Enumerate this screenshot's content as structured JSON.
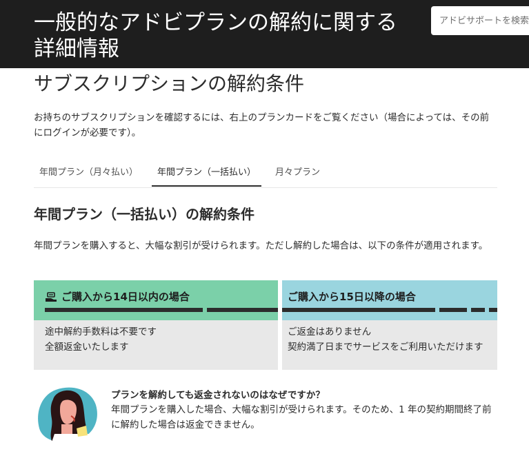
{
  "header": {
    "title": "一般的なアドビプランの解約に関する詳細情報",
    "search_placeholder": "アドビサポートを検索"
  },
  "section": {
    "title": "サブスクリプションの解約条件",
    "intro": "お持ちのサブスクリプションを確認するには、右上のプランカードをご覧ください（場合によっては、その前にログインが必要です）。"
  },
  "tabs": [
    {
      "label": "年間プラン（月々払い）",
      "active": false
    },
    {
      "label": "年間プラン（一括払い）",
      "active": true
    },
    {
      "label": "月々プラン",
      "active": false
    }
  ],
  "content": {
    "title": "年間プラン（一括払い）の解約条件",
    "description": "年間プランを購入すると、大幅な割引が受けられます。ただし解約した場合は、以下の条件が適用されます。"
  },
  "cards": [
    {
      "heading": "ご購入から14日以内の場合",
      "icon": "refund-hand-icon",
      "color": "#7bd0a9",
      "lines": [
        "途中解約手数料は不要です",
        "全額返金いたします"
      ]
    },
    {
      "heading": "ご購入から15日以降の場合",
      "color": "#9ad5df",
      "lines": [
        "ご返金はありません",
        "契約満了日までサービスをご利用いただけます"
      ]
    }
  ],
  "faq": {
    "question": "プランを解約しても返金されないのはなぜですか？",
    "answer": "年間プランを購入した場合、大幅な割引が受けられます。そのため、1 年の契約期間終了前に解約した場合は返金できません。",
    "avatar_icon": "person-avatar-illustration"
  },
  "colors": {
    "header_bg": "#1e1e1e",
    "card_body_bg": "#e8e8e8",
    "timeline": "#2c2c2c"
  }
}
